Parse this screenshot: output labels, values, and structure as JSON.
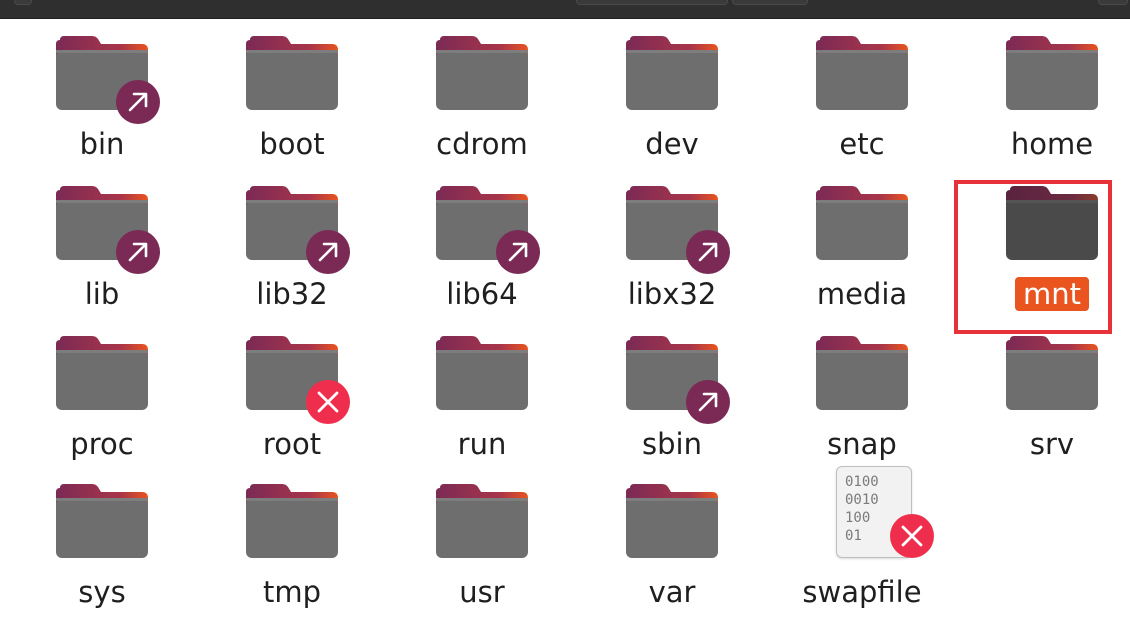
{
  "app": {
    "colors": {
      "folder_body": "#6e6e6e",
      "folder_tab": "#7b2a55",
      "folder_tab_orange": "#e9541f",
      "selection": "#e9541f",
      "highlight_border": "#e7323a",
      "badge_link": "#7b2a55",
      "badge_lock": "#ef2e4d"
    }
  },
  "items": [
    {
      "label": "bin",
      "icon": "folder-icon",
      "badge": "symlink-badge-icon"
    },
    {
      "label": "boot",
      "icon": "folder-icon",
      "badge": ""
    },
    {
      "label": "cdrom",
      "icon": "folder-icon",
      "badge": ""
    },
    {
      "label": "dev",
      "icon": "folder-icon",
      "badge": ""
    },
    {
      "label": "etc",
      "icon": "folder-icon",
      "badge": ""
    },
    {
      "label": "home",
      "icon": "folder-icon",
      "badge": ""
    },
    {
      "label": "lib",
      "icon": "folder-icon",
      "badge": "symlink-badge-icon"
    },
    {
      "label": "lib32",
      "icon": "folder-icon",
      "badge": "symlink-badge-icon"
    },
    {
      "label": "lib64",
      "icon": "folder-icon",
      "badge": "symlink-badge-icon"
    },
    {
      "label": "libx32",
      "icon": "folder-icon",
      "badge": "symlink-badge-icon"
    },
    {
      "label": "media",
      "icon": "folder-icon",
      "badge": ""
    },
    {
      "label": "mnt",
      "icon": "folder-icon",
      "badge": "",
      "selected": true
    },
    {
      "label": "proc",
      "icon": "folder-icon",
      "badge": ""
    },
    {
      "label": "root",
      "icon": "folder-icon",
      "badge": "locked-badge-icon"
    },
    {
      "label": "run",
      "icon": "folder-icon",
      "badge": ""
    },
    {
      "label": "sbin",
      "icon": "folder-icon",
      "badge": "symlink-badge-icon"
    },
    {
      "label": "snap",
      "icon": "folder-icon",
      "badge": ""
    },
    {
      "label": "srv",
      "icon": "folder-icon",
      "badge": ""
    },
    {
      "label": "sys",
      "icon": "folder-icon",
      "badge": ""
    },
    {
      "label": "tmp",
      "icon": "folder-icon",
      "badge": ""
    },
    {
      "label": "usr",
      "icon": "folder-icon",
      "badge": ""
    },
    {
      "label": "var",
      "icon": "folder-icon",
      "badge": ""
    },
    {
      "label": "swapfile",
      "icon": "binary-file-icon",
      "badge": "locked-badge-icon",
      "file_text": "0100\n0010\n100\n01"
    }
  ]
}
